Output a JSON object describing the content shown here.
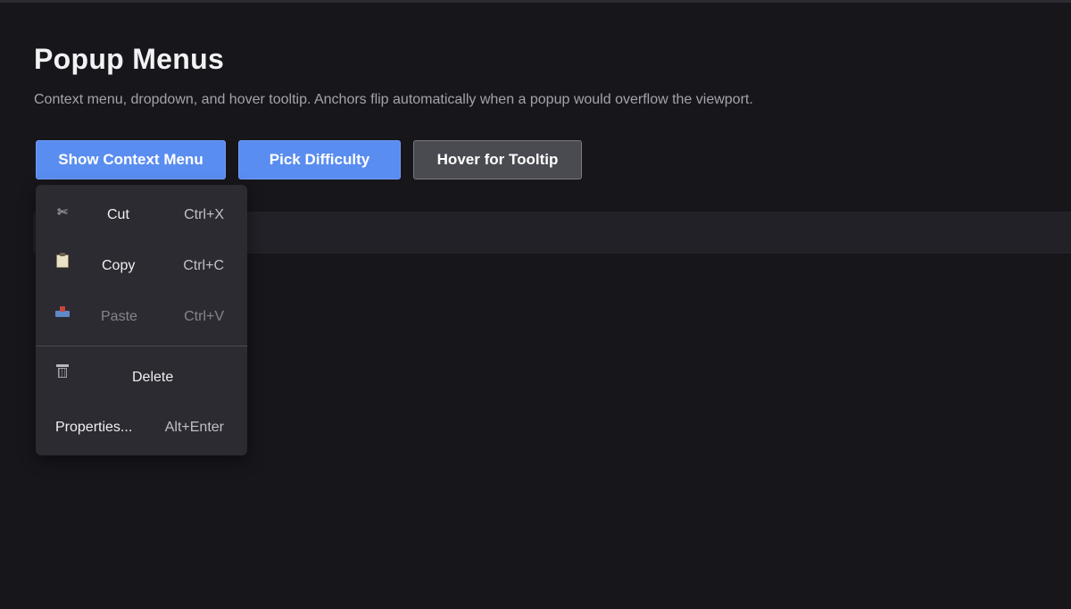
{
  "page": {
    "title": "Popup Menus",
    "subtitle": "Context menu, dropdown, and hover tooltip. Anchors flip automatically when a popup would overflow the viewport."
  },
  "buttons": {
    "context_menu": "Show Context Menu",
    "difficulty": "Pick Difficulty",
    "tooltip": "Hover for Tooltip"
  },
  "context_menu": {
    "items": [
      {
        "icon": "scissors-icon",
        "glyph": "✄",
        "label": "Cut",
        "shortcut": "Ctrl+X",
        "disabled": false
      },
      {
        "icon": "clipboard-icon",
        "label": "Copy",
        "shortcut": "Ctrl+C",
        "disabled": false
      },
      {
        "icon": "inbox-tray-icon",
        "label": "Paste",
        "shortcut": "Ctrl+V",
        "disabled": true
      },
      {
        "icon": "wastebasket-icon",
        "label": "Delete",
        "shortcut": "",
        "disabled": false
      },
      {
        "icon": "",
        "label": "Properties...",
        "shortcut": "Alt+Enter",
        "disabled": false
      }
    ]
  },
  "colors": {
    "background": "#17161b",
    "primary_button": "#5a8df0",
    "secondary_button": "#4a4a51",
    "menu_background": "#2c2b31"
  }
}
